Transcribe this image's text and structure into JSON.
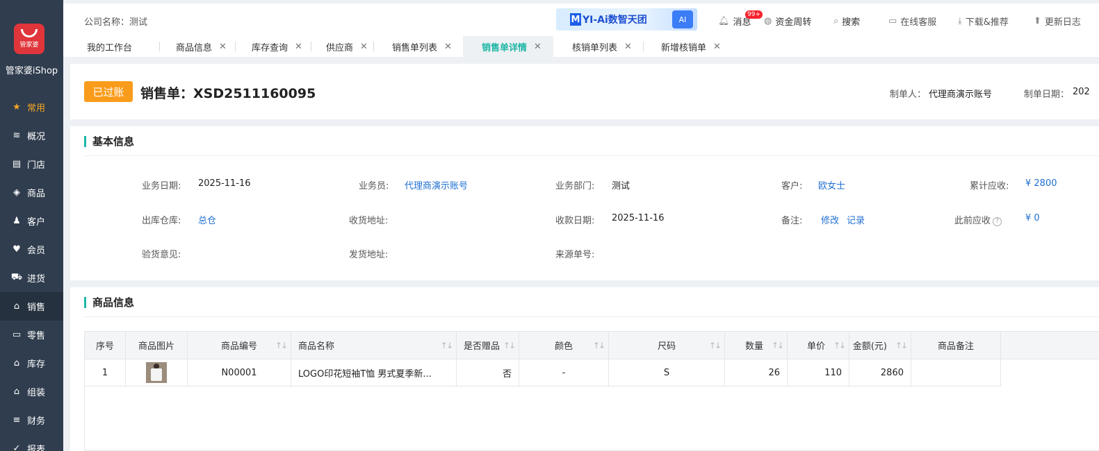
{
  "sidebar": {
    "logo_text": "管家婆",
    "brand": "管家婆iShop",
    "items": [
      {
        "label": "常用",
        "icon": "star-icon"
      },
      {
        "label": "概况",
        "icon": "layers-icon"
      },
      {
        "label": "门店",
        "icon": "store-icon"
      },
      {
        "label": "商品",
        "icon": "goods-icon"
      },
      {
        "label": "客户",
        "icon": "customer-icon"
      },
      {
        "label": "会员",
        "icon": "heart-icon"
      },
      {
        "label": "进货",
        "icon": "cart-icon"
      },
      {
        "label": "销售",
        "icon": "basket-icon"
      },
      {
        "label": "零售",
        "icon": "register-icon"
      },
      {
        "label": "库存",
        "icon": "warehouse-icon"
      },
      {
        "label": "组装",
        "icon": "assembly-icon"
      },
      {
        "label": "财务",
        "icon": "coins-icon"
      },
      {
        "label": "报表",
        "icon": "report-icon"
      }
    ]
  },
  "header": {
    "company": "公司名称：测试",
    "promo": {
      "mark": "M",
      "text": "YI-Ai数智天团",
      "ai": "AI"
    },
    "badge": "99+",
    "tools": {
      "messages": "消息",
      "funds": "资金周转",
      "search": "搜索",
      "service": "在线客服",
      "download": "下载&推荐",
      "update": "更新日志"
    }
  },
  "tabs": [
    {
      "label": "我的工作台"
    },
    {
      "label": "商品信息"
    },
    {
      "label": "库存查询"
    },
    {
      "label": "供应商"
    },
    {
      "label": "销售单列表"
    },
    {
      "label": "销售单详情"
    },
    {
      "label": "核销单列表"
    },
    {
      "label": "新增核销单"
    }
  ],
  "order": {
    "status": "已过账",
    "title": "销售单：XSD2511160095",
    "maker_label": "制单人：",
    "maker": "代理商演示账号",
    "date_label": "制单日期：",
    "date": "202"
  },
  "basic": {
    "title": "基本信息",
    "biz_date_label": "业务日期:",
    "biz_date": "2025-11-16",
    "salesman_label": "业务员:",
    "salesman": "代理商演示账号",
    "dept_label": "业务部门:",
    "dept": "测试",
    "customer_label": "客户:",
    "customer": "欧女士",
    "receivable_label": "累计应收:",
    "receivable": "¥ 2800",
    "warehouse_label": "出库仓库:",
    "warehouse": "总仓",
    "recv_addr_label": "收货地址:",
    "collect_date_label": "收款日期:",
    "collect_date": "2025-11-16",
    "remark_label": "备注:",
    "remark_edit": "修改",
    "remark_log": "记录",
    "prev_receivable_label": "此前应收",
    "prev_receivable": "¥ 0",
    "inspect_label": "验货意见:",
    "ship_addr_label": "发货地址:",
    "source_label": "来源单号:"
  },
  "goods": {
    "title": "商品信息",
    "columns": [
      "序号",
      "商品图片",
      "商品编号",
      "商品名称",
      "是否赠品",
      "颜色",
      "尺码",
      "数量",
      "单价",
      "金额(元)",
      "商品备注"
    ],
    "rows": [
      {
        "no": "1",
        "code": "N00001",
        "name": "LOGO印花短袖T恤 男式夏季新...",
        "gift": "否",
        "color": "-",
        "size": "S",
        "qty": "26",
        "price": "110",
        "amount": "2860",
        "remark": ""
      }
    ]
  }
}
